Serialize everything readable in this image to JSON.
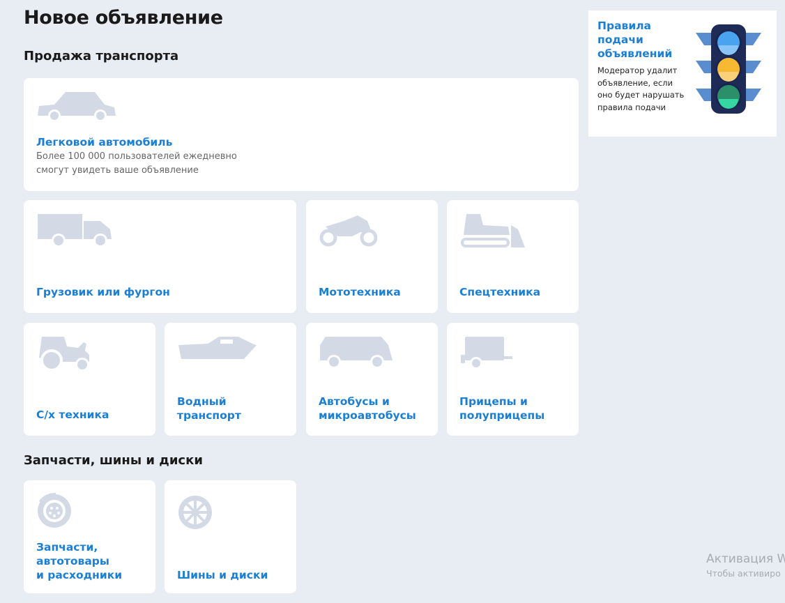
{
  "page": {
    "title": "Новое объявление"
  },
  "sections": {
    "transport": "Продажа транспорта",
    "parts": "Запчасти, шины и диски"
  },
  "cards": {
    "car": {
      "title": "Легковой автомобиль",
      "desc": "Более 100 000 пользователей ежедневно\nсмогут увидеть ваше объявление",
      "icon": "car-icon"
    },
    "truck": {
      "title": "Грузовик или фургон",
      "icon": "truck-icon"
    },
    "moto": {
      "title": "Мототехника",
      "icon": "motorcycle-icon"
    },
    "special": {
      "title": "Спецтехника",
      "icon": "bulldozer-icon"
    },
    "agri": {
      "title": "С/х техника",
      "icon": "tractor-icon"
    },
    "water": {
      "title": "Водный\nтранспорт",
      "icon": "boat-icon"
    },
    "bus": {
      "title": "Автобусы и\nмикроавтобусы",
      "icon": "bus-icon"
    },
    "trailer": {
      "title": "Прицепы и\nполуприцепы",
      "icon": "trailer-icon"
    },
    "parts": {
      "title": "Запчасти,\nавтотовары\nи расходники",
      "icon": "brake-disc-icon"
    },
    "tires": {
      "title": "Шины и диски",
      "icon": "wheel-icon"
    }
  },
  "rules": {
    "title": "Правила\nподачи\nобъявлений",
    "text": "Модератор удалит\nобъявление, если\nоно будет нарушать\nправила подачи",
    "icon": "traffic-light-icon"
  },
  "watermark": {
    "line1": "Активация W",
    "line2": "Чтобы активиро"
  },
  "colors": {
    "accent": "#1b7fd3",
    "background": "#e8ecf3",
    "icon": "#d3dae6"
  }
}
